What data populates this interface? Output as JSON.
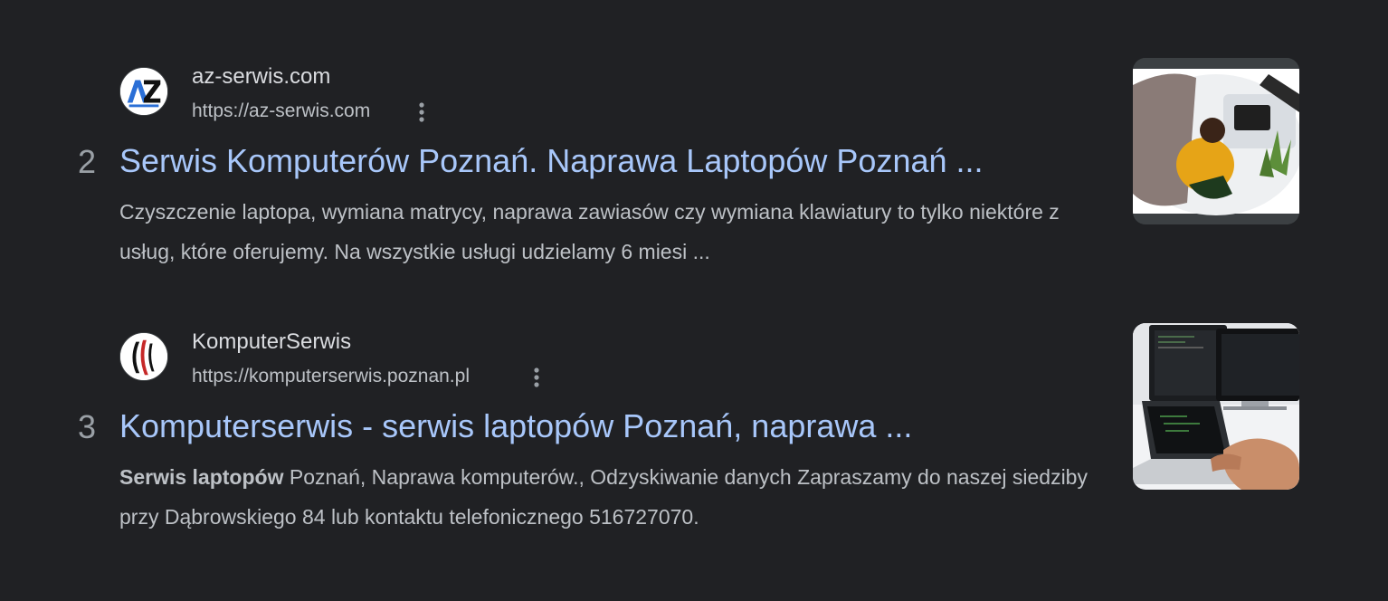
{
  "results": [
    {
      "rank": "2",
      "favicon_icon": "az-serwis-logo-icon",
      "site_name": "az-serwis.com",
      "url": "https://az-serwis.com",
      "title": "Serwis Komputerów Poznań. Naprawa Laptopów Poznań ...",
      "snippet": "Czyszczenie laptopa, wymiana matrycy, naprawa zawiasów czy wymiana klawiatury to tylko niektóre z usług, które oferujemy. Na wszystkie usługi udzielamy 6 miesi ...",
      "thumbnail": "person-at-desk-with-laptop-image"
    },
    {
      "rank": "3",
      "favicon_icon": "komputerserwis-logo-icon",
      "site_name": "KomputerSerwis",
      "url": "https://komputerserwis.poznan.pl",
      "title": "Komputerserwis - serwis laptopów Poznań, naprawa ...",
      "snippet_bold": "Serwis laptopów",
      "snippet": " Poznań, Naprawa komputerów., Odzyskiwanie danych Zapraszamy do naszej siedziby przy Dąbrowskiego 84 lub kontaktu telefonicznego 516727070.",
      "thumbnail": "laptop-and-monitors-image"
    }
  ],
  "colors": {
    "background": "#202124",
    "title_link": "#a8c7fa",
    "text": "#bdc1c6",
    "rank": "#9aa0a6"
  },
  "icons": {
    "more_options": "three-dots-vertical-icon"
  }
}
